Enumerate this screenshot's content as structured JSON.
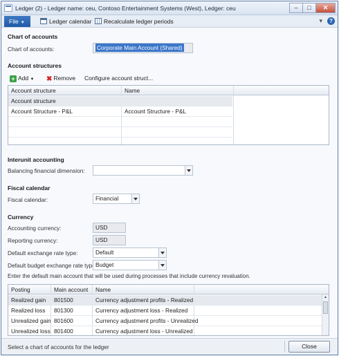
{
  "window": {
    "title": "Ledger (2) - Ledger name: ceu, Contoso Entertainment Systems (West), Ledger: ceu",
    "buttons": {
      "minimize": "–",
      "maximize": "□",
      "close": "✕"
    }
  },
  "ribbon": {
    "file_label": "File",
    "ledger_calendar_label": "Ledger calendar",
    "recalculate_label": "Recalculate ledger periods",
    "help_label": "?"
  },
  "chart_of_accounts": {
    "section_title": "Chart of accounts",
    "label": "Chart of accounts:",
    "value": "Corporate Main Account (Shared)"
  },
  "account_structures": {
    "section_title": "Account structures",
    "toolbar": {
      "add_label": "Add",
      "remove_label": "Remove",
      "configure_label": "Configure account struct..."
    },
    "columns": [
      "Account structure",
      "Name"
    ],
    "rows": [
      {
        "account_structure": "Account structure",
        "name": ""
      },
      {
        "account_structure": "Account Structure - P&L",
        "name": "Account Structure - P&L"
      }
    ]
  },
  "interunit_accounting": {
    "section_title": "Interunit accounting",
    "balancing_label": "Balancing financial dimension:",
    "balancing_value": ""
  },
  "fiscal_calendar": {
    "section_title": "Fiscal calendar",
    "label": "Fiscal calendar:",
    "value": "Financial"
  },
  "currency": {
    "section_title": "Currency",
    "accounting_currency_label": "Accounting currency:",
    "accounting_currency_value": "USD",
    "reporting_currency_label": "Reporting currency:",
    "reporting_currency_value": "USD",
    "exchange_rate_type_label": "Default exchange rate type:",
    "exchange_rate_type_value": "Default",
    "budget_exchange_rate_type_label": "Default budget exchange rate type:",
    "budget_exchange_rate_type_value": "Budget",
    "revaluation_instruction": "Enter the default main account that will be used during processes that include currency revaluation."
  },
  "revaluation_grid": {
    "columns": [
      "Posting",
      "Main account",
      "Name"
    ],
    "rows": [
      {
        "posting": "Realized gain",
        "main_account": "801500",
        "name": "Currency adjustment profits - Realized"
      },
      {
        "posting": "Realized loss",
        "main_account": "801300",
        "name": "Currency adjustment loss - Realized"
      },
      {
        "posting": "Unrealized gain",
        "main_account": "801600",
        "name": "Currency adjustment profits - Unrealized"
      },
      {
        "posting": "Unrealized loss",
        "main_account": "801400",
        "name": "Currency adjustment loss - Unrealized"
      }
    ]
  },
  "status_bar": {
    "message": "Select a chart of accounts for the ledger",
    "close_label": "Close"
  },
  "colors": {
    "accent": "#2a5ea8",
    "selection": "#3a76c9"
  }
}
